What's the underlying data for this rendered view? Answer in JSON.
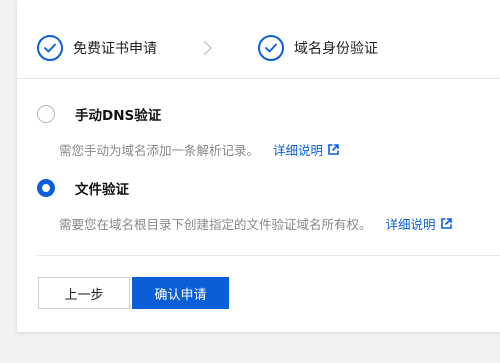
{
  "steps": [
    {
      "label": "免费证书申请",
      "icon": "check-circle-icon"
    },
    {
      "label": "域名身份验证",
      "icon": "check-circle-icon"
    }
  ],
  "options": [
    {
      "title": "手动DNS验证",
      "selected": false,
      "description": "需您手动为域名添加一条解析记录。",
      "link": "详细说明",
      "link_icon": "external-link-icon"
    },
    {
      "title": "文件验证",
      "selected": true,
      "description": "需要您在域名根目录下创建指定的文件验证域名所有权。",
      "link": "详细说明",
      "link_icon": "external-link-icon"
    }
  ],
  "buttons": {
    "prev": "上一步",
    "confirm": "确认申请"
  },
  "colors": {
    "accent": "#0a5fd8",
    "muted_text": "#888888",
    "border": "#e5e5e5"
  }
}
